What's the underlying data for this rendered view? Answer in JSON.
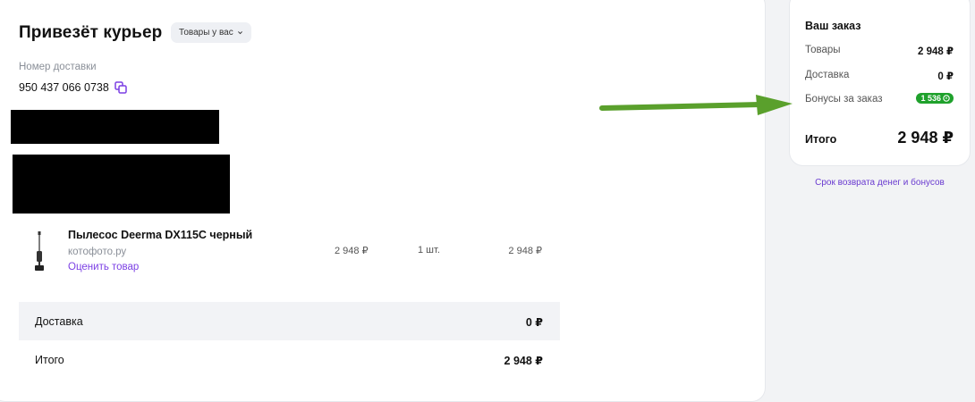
{
  "header": {
    "title": "Привезёт курьер",
    "chip_label": "Товары у вас"
  },
  "delivery": {
    "label": "Номер доставки",
    "number": "950 437 066 0738"
  },
  "product": {
    "name": "Пылесос Deerma DX115C черный",
    "seller": "котофото.ру",
    "rate_link": "Оценить товар",
    "price": "2 948 ₽",
    "quantity": "1 шт.",
    "total": "2 948 ₽"
  },
  "summary": {
    "delivery_label": "Доставка",
    "delivery_value": "0 ₽",
    "total_label": "Итого",
    "total_value": "2 948 ₽"
  },
  "order": {
    "title": "Ваш заказ",
    "items_label": "Товары",
    "items_value": "2 948 ₽",
    "delivery_label": "Доставка",
    "delivery_value": "0 ₽",
    "bonus_label": "Бонусы за заказ",
    "bonus_value": "1 536",
    "total_label": "Итого",
    "total_value": "2 948 ₽",
    "refund_link": "Срок возврата денег и бонусов"
  },
  "colors": {
    "accent": "#7b3fe4",
    "bonus_green": "#1fa12c",
    "arrow_green": "#5aa02c"
  },
  "icons": {
    "copy": "copy-icon",
    "chevron": "chevron-down-icon",
    "bonus_coin": "coin-icon",
    "arrow": "arrow-right-icon"
  }
}
